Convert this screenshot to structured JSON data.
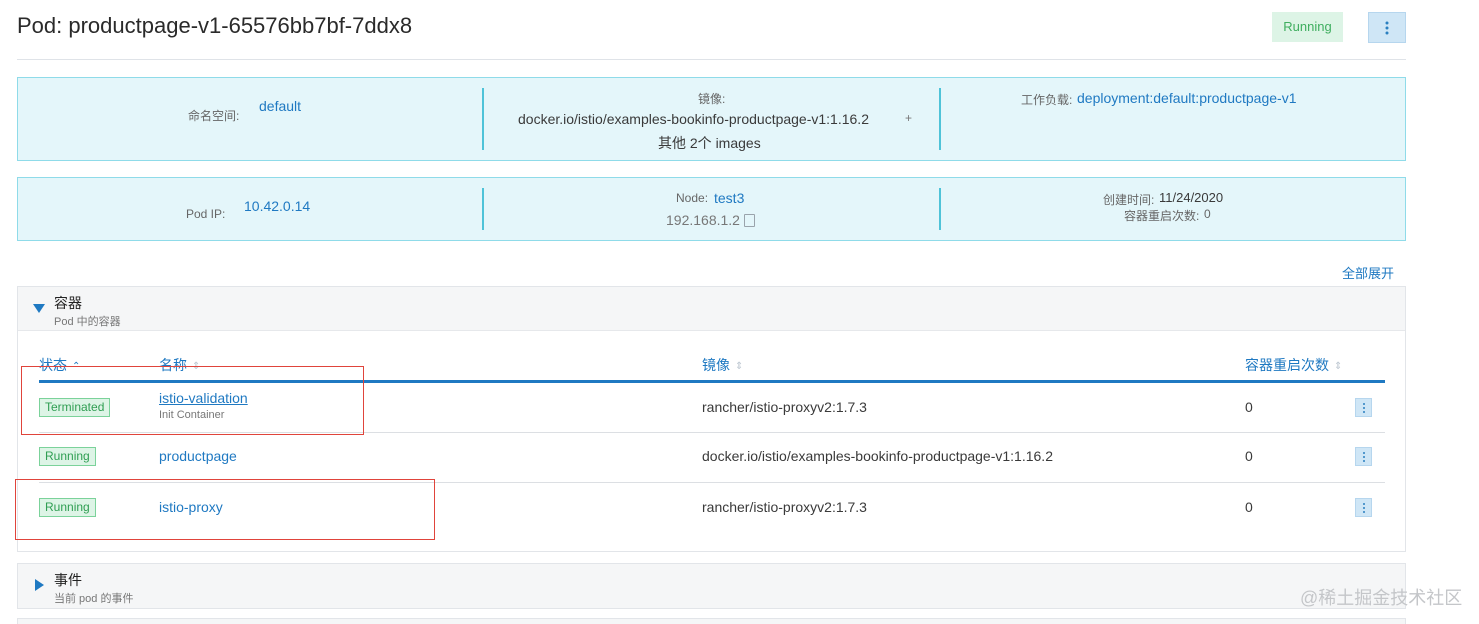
{
  "header": {
    "title": "Pod: productpage-v1-65576bb7bf-7ddx8",
    "state": "Running"
  },
  "info_top": {
    "namespace_label": "命名空间:",
    "namespace_value": "default",
    "image_label": "镜像:",
    "image_value": "docker.io/istio/examples-bookinfo-productpage-v1:1.16.2",
    "image_more": "其他 2个 images",
    "workload_label": "工作负载:",
    "workload_value": "deployment:default:productpage-v1"
  },
  "info_bottom": {
    "podip_label": "Pod IP:",
    "podip_value": "10.42.0.14",
    "node_label": "Node:",
    "node_value": "test3",
    "node_ip": "192.168.1.2",
    "created_label": "创建时间:",
    "created_value": "11/24/2020",
    "restarts_label": "容器重启次数:",
    "restarts_value": "0"
  },
  "expand_all": "全部展开",
  "containers_section": {
    "title": "容器",
    "subtitle": "Pod 中的容器",
    "columns": {
      "state": "状态",
      "name": "名称",
      "image": "镜像",
      "restarts": "容器重启次数"
    },
    "rows": [
      {
        "state": "Terminated",
        "name": "istio-validation",
        "sub": "Init Container",
        "image": "rancher/istio-proxyv2:1.7.3",
        "restarts": "0"
      },
      {
        "state": "Running",
        "name": "productpage",
        "sub": "",
        "image": "docker.io/istio/examples-bookinfo-productpage-v1:1.16.2",
        "restarts": "0"
      },
      {
        "state": "Running",
        "name": "istio-proxy",
        "sub": "",
        "image": "rancher/istio-proxyv2:1.7.3",
        "restarts": "0"
      }
    ]
  },
  "events_section": {
    "title": "事件",
    "subtitle": "当前 pod 的事件"
  },
  "watermark": "@稀土掘金技术社区",
  "colors": {
    "accent": "#1f79c2",
    "running_bg": "#ddf4e6",
    "running_text": "#2f9e52",
    "info_bg": "#e4f6fa",
    "highlight": "#e0443b"
  }
}
